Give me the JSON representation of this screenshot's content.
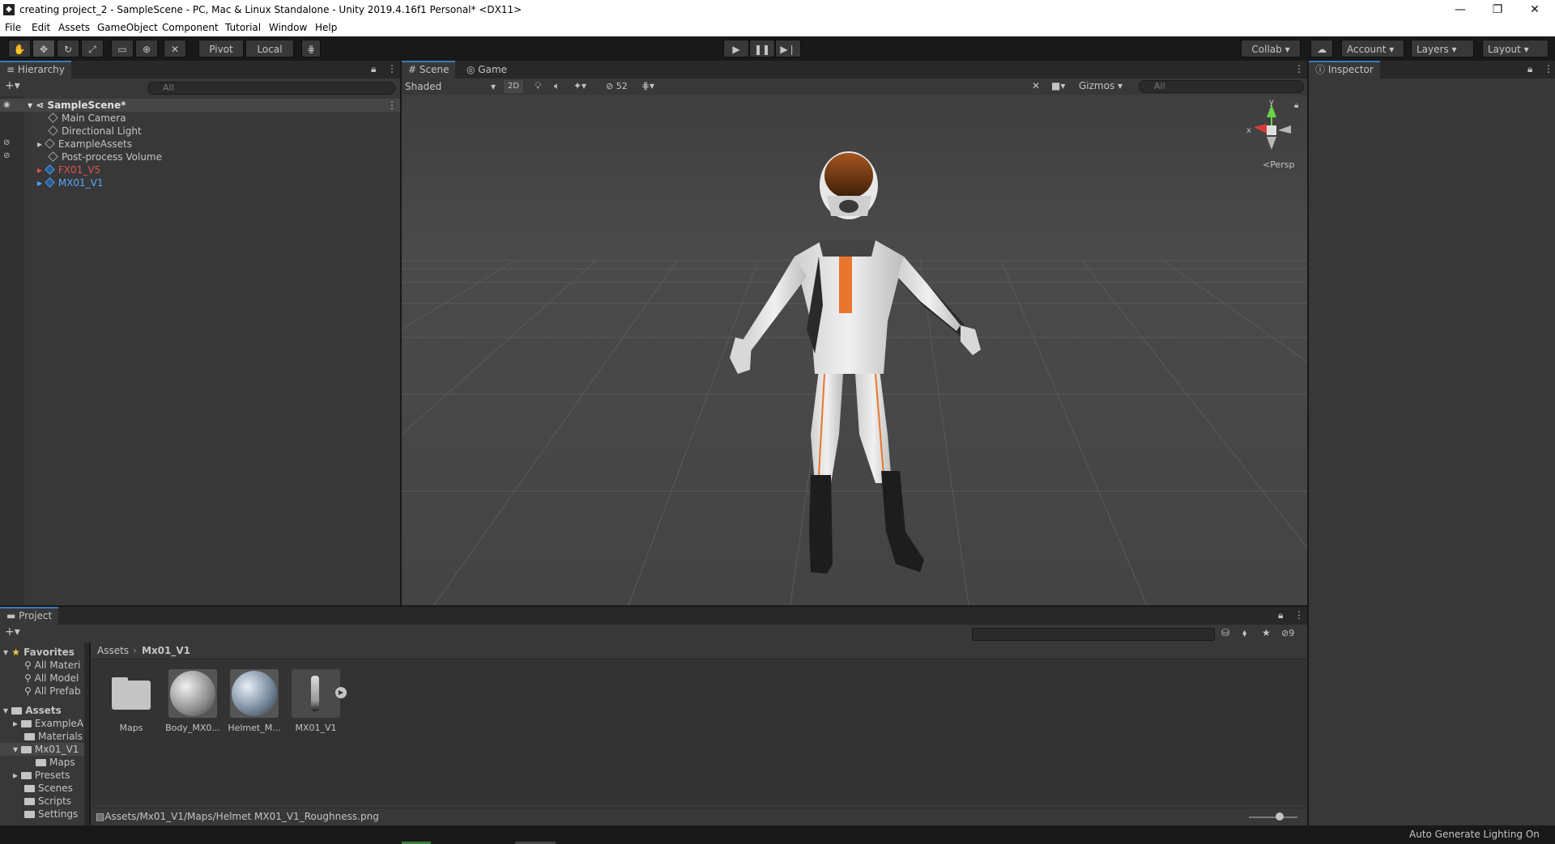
{
  "window": {
    "title": "creating project_2 - SampleScene - PC, Mac & Linux Standalone - Unity 2019.4.16f1 Personal* <DX11>",
    "controls": {
      "minimize": "—",
      "restore": "❐",
      "close": "✕"
    }
  },
  "menu": [
    "File",
    "Edit",
    "Assets",
    "GameObject",
    "Component",
    "Tutorial",
    "Window",
    "Help"
  ],
  "toolbar": {
    "pivot": "Pivot",
    "local": "Local",
    "collab": "Collab",
    "account": "Account",
    "layers": "Layers",
    "layout": "Layout"
  },
  "hierarchy": {
    "tab": "Hierarchy",
    "search_placeholder": "All",
    "scene": "SampleScene*",
    "items": [
      {
        "label": "Main Camera",
        "color": "#c4c4c4"
      },
      {
        "label": "Directional Light",
        "color": "#c4c4c4"
      },
      {
        "label": "ExampleAssets",
        "color": "#c4c4c4"
      },
      {
        "label": "Post-process Volume",
        "color": "#c4c4c4"
      },
      {
        "label": "FX01_V5",
        "color": "#e05252"
      },
      {
        "label": "MX01_V1",
        "color": "#58a7ff"
      }
    ]
  },
  "scene": {
    "tabs": [
      "Scene",
      "Game"
    ],
    "shading": "Shaded",
    "mode_2d": "2D",
    "hidden_count": "52",
    "gizmos": "Gizmos",
    "search_placeholder": "All",
    "axis_y": "y",
    "axis_x": "x",
    "persp": "Persp"
  },
  "inspector": {
    "tab": "Inspector"
  },
  "project": {
    "tab": "Project",
    "hidden_count": "9",
    "favorites_label": "Favorites",
    "favorites": [
      "All Materi",
      "All Model",
      "All Prefab"
    ],
    "assets_label": "Assets",
    "assets_tree": [
      "ExampleA",
      "Materials",
      "Mx01_V1",
      "Maps",
      "Presets",
      "Scenes",
      "Scripts",
      "Settings"
    ],
    "breadcrumb": [
      "Assets",
      "Mx01_V1"
    ],
    "grid_items": [
      "Maps",
      "Body_MX0...",
      "Helmet_M...",
      "MX01_V1"
    ],
    "status_path": "Assets/Mx01_V1/Maps/Helmet MX01_V1_Roughness.png"
  },
  "statusbar": {
    "text": "Auto Generate Lighting On"
  },
  "colors": {
    "accent": "#3a79bb",
    "suit_orange": "#e8762c"
  }
}
